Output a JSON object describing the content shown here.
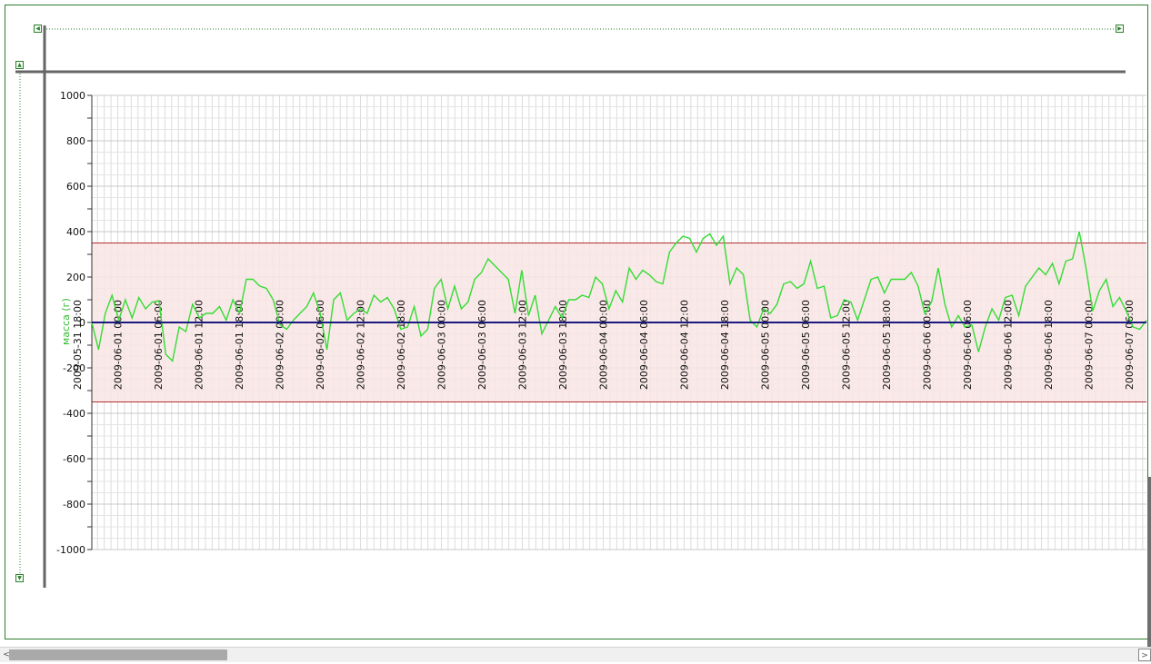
{
  "chart_data": {
    "type": "line",
    "title": "",
    "xlabel": "",
    "ylabel": "масса (г)",
    "ylim": [
      -1000,
      1000
    ],
    "y_ticks": [
      1000,
      800,
      600,
      400,
      200,
      0,
      -200,
      -400,
      -600,
      -800,
      -1000
    ],
    "y_tick_labels": [
      "1000",
      "800",
      "600",
      "400",
      "200",
      "0",
      "-200",
      "-400",
      "-600",
      "-800",
      "-1000"
    ],
    "x_tick_labels": [
      "2009-05-31 18:00",
      "2009-06-01 00:00",
      "2009-06-01 06:00",
      "2009-06-01 12:00",
      "2009-06-01 18:00",
      "2009-06-02 00:00",
      "2009-06-02 06:00",
      "2009-06-02 12:00",
      "2009-06-02 18:00",
      "2009-06-03 00:00",
      "2009-06-03 06:00",
      "2009-06-03 12:00",
      "2009-06-03 18:00",
      "2009-06-04 00:00",
      "2009-06-04 06:00",
      "2009-06-04 12:00",
      "2009-06-04 18:00",
      "2009-06-05 00:00",
      "2009-06-05 06:00",
      "2009-06-05 12:00",
      "2009-06-05 18:00",
      "2009-06-06 00:00",
      "2009-06-06 06:00",
      "2009-06-06 12:00",
      "2009-06-06 18:00",
      "2009-06-07 00:00",
      "2009-06-07 06:00"
    ],
    "threshold_band": {
      "upper": 350,
      "lower": -350
    },
    "baseline": 0,
    "grid": true,
    "series": [
      {
        "color": "#33dd33",
        "values": [
          0,
          -120,
          40,
          120,
          10,
          100,
          20,
          110,
          60,
          90,
          95,
          -140,
          -170,
          -20,
          -40,
          80,
          20,
          40,
          40,
          70,
          10,
          100,
          40,
          190,
          190,
          160,
          150,
          100,
          -10,
          -30,
          10,
          40,
          70,
          130,
          40,
          -120,
          100,
          130,
          10,
          40,
          60,
          40,
          120,
          90,
          110,
          60,
          -30,
          -20,
          70,
          -60,
          -30,
          150,
          190,
          60,
          160,
          60,
          90,
          190,
          220,
          280,
          250,
          220,
          190,
          40,
          230,
          30,
          120,
          -50,
          10,
          70,
          20,
          100,
          100,
          120,
          110,
          200,
          170,
          60,
          140,
          90,
          240,
          190,
          230,
          210,
          180,
          170,
          310,
          350,
          380,
          370,
          310,
          370,
          390,
          340,
          380,
          170,
          240,
          210,
          10,
          -20,
          60,
          40,
          80,
          170,
          180,
          150,
          170,
          270,
          150,
          160,
          20,
          30,
          100,
          90,
          10,
          100,
          190,
          200,
          130,
          190,
          190,
          190,
          220,
          160,
          40,
          90,
          240,
          80,
          -20,
          30,
          -20,
          -10,
          -130,
          -20,
          60,
          10,
          110,
          120,
          30,
          160,
          200,
          240,
          210,
          260,
          170,
          270,
          280,
          400,
          240,
          50,
          140,
          190,
          70,
          110,
          50,
          -20,
          -30,
          10
        ]
      }
    ]
  }
}
